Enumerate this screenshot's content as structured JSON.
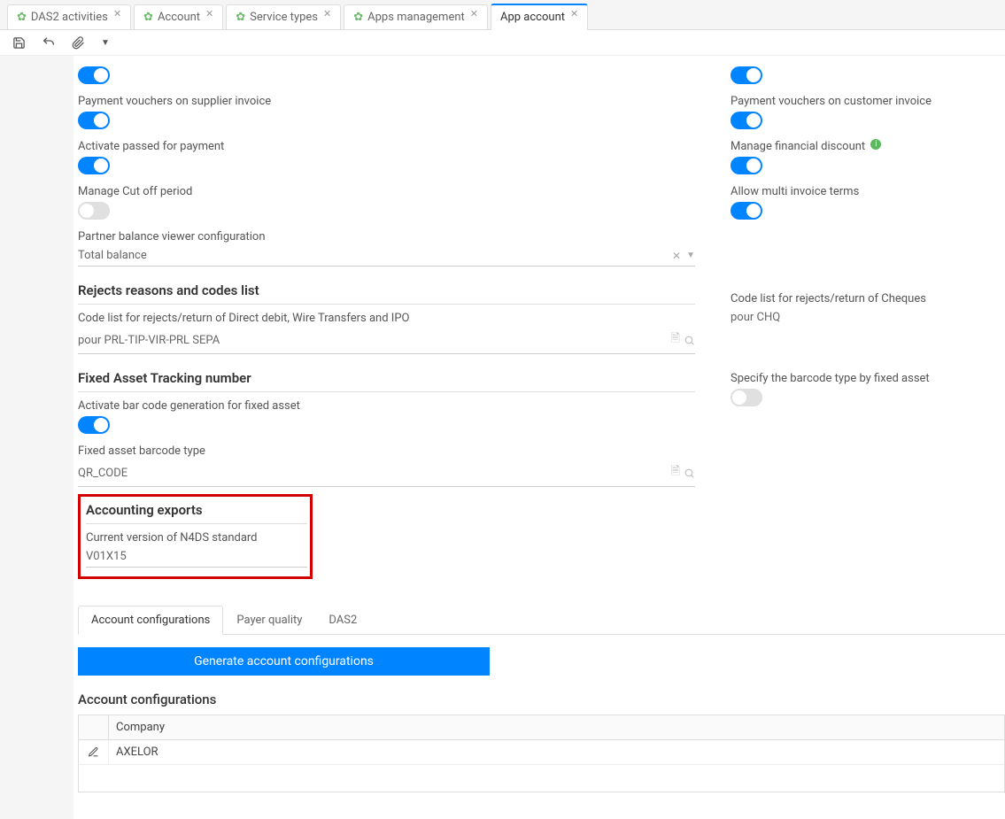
{
  "tabs": [
    {
      "label": "DAS2 activities"
    },
    {
      "label": "Account"
    },
    {
      "label": "Service types"
    },
    {
      "label": "Apps management"
    },
    {
      "label": "App account"
    }
  ],
  "left": {
    "payment_vouchers_supplier": "Payment vouchers on supplier invoice",
    "activate_passed_for_payment": "Activate passed for payment",
    "manage_cut_off": "Manage Cut off period",
    "partner_balance_label": "Partner balance viewer configuration",
    "partner_balance_value": "Total balance",
    "rejects_heading": "Rejects reasons and codes list",
    "rejects_left_label": "Code list for rejects/return of Direct debit, Wire Transfers and IPO",
    "rejects_left_value": "pour PRL-TIP-VIR-PRL SEPA",
    "fixed_asset_heading": "Fixed Asset Tracking number",
    "activate_barcode_label": "Activate bar code generation for fixed asset",
    "barcode_type_label": "Fixed asset barcode type",
    "barcode_type_value": "QR_CODE",
    "accounting_exports_heading": "Accounting exports",
    "n4ds_label": "Current version of N4DS standard",
    "n4ds_value": "V01X15"
  },
  "right": {
    "payment_vouchers_customer": "Payment vouchers on customer invoice",
    "manage_financial_discount": "Manage financial discount",
    "allow_multi_invoice": "Allow multi invoice terms",
    "rejects_right_label": "Code list for rejects/return of Cheques",
    "rejects_right_value": "pour CHQ",
    "specify_barcode_label": "Specify the barcode type by fixed asset"
  },
  "sub": {
    "tabs": [
      "Account configurations",
      "Payer quality",
      "DAS2"
    ],
    "generate_btn": "Generate account configurations",
    "table_heading": "Account configurations",
    "col_company": "Company",
    "row_company": "AXELOR"
  }
}
